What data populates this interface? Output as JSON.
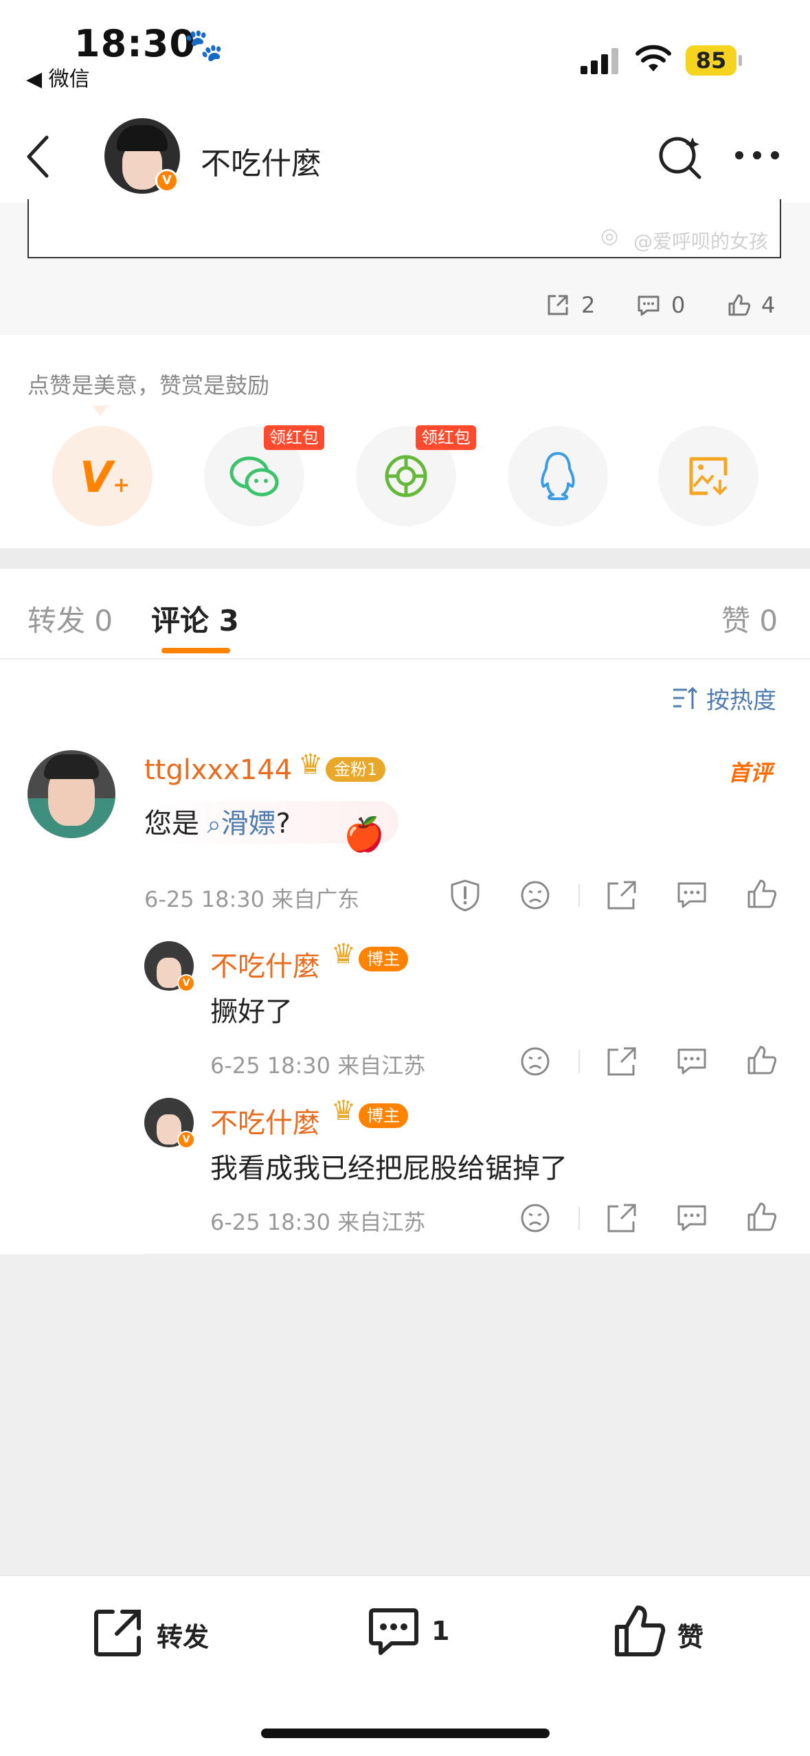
{
  "status_bar": {
    "time": "18:30",
    "back_app": "◀ 微信",
    "battery": "85"
  },
  "header": {
    "title": "不吃什麼"
  },
  "post": {
    "watermark": "@爱呼呗的女孩",
    "repost_count": "2",
    "comment_count": "0",
    "like_count": "4"
  },
  "reward": {
    "text": "点赞是美意，赞赏是鼓励",
    "redpack_label_1": "领红包",
    "redpack_label_2": "领红包"
  },
  "tabs": {
    "repost": "转发 0",
    "comments": "评论 3",
    "likes": "赞 0"
  },
  "sort": {
    "label": "按热度"
  },
  "comments": [
    {
      "user": "ttglxxx144",
      "badge": "金粉1",
      "hot_label": "首评",
      "text_prefix": "您是",
      "text_keyword": "滑嫖",
      "text_suffix": "?",
      "meta": "6-25 18:30 来自广东"
    },
    {
      "user": "不吃什麼",
      "badge": "博主",
      "text": "撅好了",
      "meta": "6-25 18:30 来自江苏"
    },
    {
      "user": "不吃什麼",
      "badge": "博主",
      "text": "我看成我已经把屁股给锯掉了",
      "meta": "6-25 18:30 来自江苏"
    }
  ],
  "toolbar": {
    "repost": "转发",
    "comment_count": "1",
    "like": "赞"
  },
  "colors": {
    "accent": "#ff8200",
    "username": "#e86b1e",
    "link": "#507daf",
    "redpack": "#ff4a2e"
  }
}
